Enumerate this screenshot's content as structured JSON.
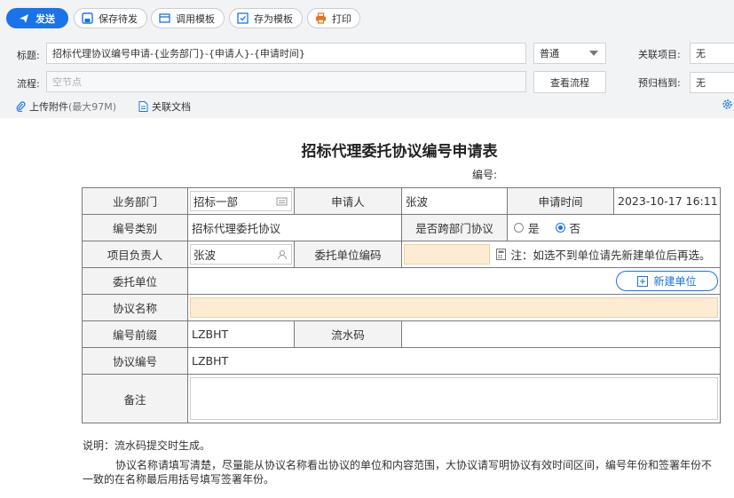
{
  "toolbar": {
    "send": "发送",
    "save_draft": "保存待发",
    "use_template": "调用模板",
    "save_template": "存为模板",
    "print": "打印"
  },
  "header": {
    "title_label": "标题:",
    "title_value": "招标代理协议编号申请-{业务部门}-{申请人}-{申请时间}",
    "priority_value": "普通",
    "related_project_label": "关联项目:",
    "related_project_value": "无",
    "flow_label": "流程:",
    "flow_placeholder": "空节点",
    "view_flow": "查看流程",
    "archive_label": "预归档到:",
    "archive_value": "无",
    "upload": "上传附件",
    "upload_limit": "(最大97M)",
    "related_doc": "关联文档"
  },
  "form": {
    "title": "招标代理委托协议编号申请表",
    "serial_label": "编号:",
    "rows": {
      "dept_label": "业务部门",
      "dept_value": "招标一部",
      "applicant_label": "申请人",
      "applicant_value": "张波",
      "time_label": "申请时间",
      "time_value": "2023-10-17 16:11",
      "category_label": "编号类别",
      "category_value": "招标代理委托协议",
      "cross_label": "是否跨部门协议",
      "yes": "是",
      "no": "否",
      "cross_selected": "否",
      "manager_label": "项目负责人",
      "manager_value": "张波",
      "client_code_label": "委托单位编码",
      "client_code_note": "注：如选不到单位请先新建单位后再选。",
      "client_label": "委托单位",
      "new_unit": "新建单位",
      "agreement_name_label": "协议名称",
      "prefix_label": "编号前缀",
      "prefix_value": "LZBHT",
      "serial_code_label": "流水码",
      "agreement_no_label": "协议编号",
      "agreement_no_value": "LZBHT",
      "remark_label": "备注"
    },
    "notes": {
      "line1": "说明：流水码提交时生成。",
      "line2": "协议名称请填写清楚，尽量能从协议名称看出协议的单位和内容范围，大协议请写明协议有效时间区间，编号年份和签署年份不一致的在名称最后用括号填写签署年份。"
    }
  },
  "colors": {
    "accent": "#1a73e8",
    "highlight_field": "#fdebd2"
  }
}
